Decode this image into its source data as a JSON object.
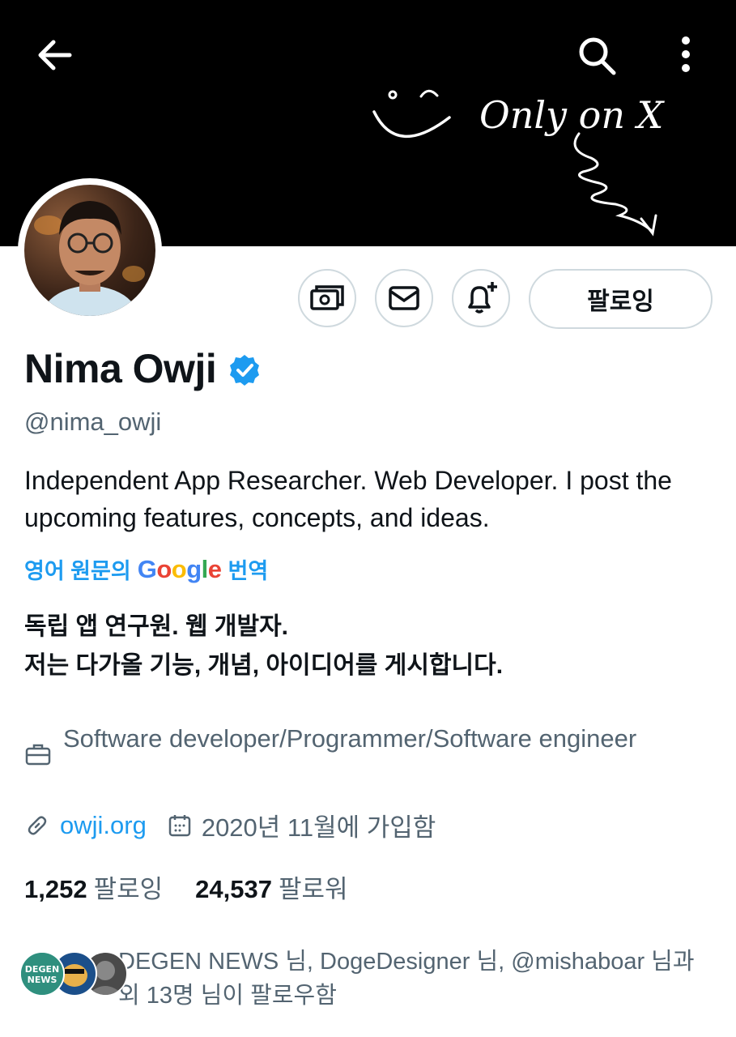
{
  "header": {
    "back_icon": "arrow-left-icon",
    "search_icon": "search-icon",
    "more_icon": "more-vertical-icon",
    "banner_text": "Only on X"
  },
  "actions": {
    "subscribe_icon": "money-icon",
    "message_icon": "envelope-icon",
    "notify_icon": "bell-plus-icon",
    "follow_label": "팔로잉"
  },
  "profile": {
    "name": "Nima Owji",
    "verified": true,
    "handle": "@nima_owji",
    "bio": "Independent App Researcher. Web Developer. I post the upcoming features, concepts, and ideas.",
    "translate_prefix": "영어 원문의",
    "translate_google": [
      "G",
      "o",
      "o",
      "g",
      "l",
      "e"
    ],
    "translate_suffix": "번역",
    "translated_line1": "독립 앱 연구원. 웹 개발자.",
    "translated_line2": "저는 다가올 기능, 개념, 아이디어를 게시합니다.",
    "profession": "Software developer/Programmer/Software engineer",
    "website": "owji.org",
    "joined": "2020년 11월에 가입함",
    "following_count": "1,252",
    "following_label": "팔로잉",
    "followers_count": "24,537",
    "followers_label": "팔로워",
    "known_followers": "DEGEN NEWS 님, DogeDesigner 님, @mishaboar 님과 외 13명 님이 팔로우함",
    "mini_avatar_1_text": "DEGEN NEWS"
  },
  "colors": {
    "accent": "#1d9bf0",
    "secondary_text": "#536471",
    "border": "#cfd9de",
    "banner": "#000000"
  }
}
